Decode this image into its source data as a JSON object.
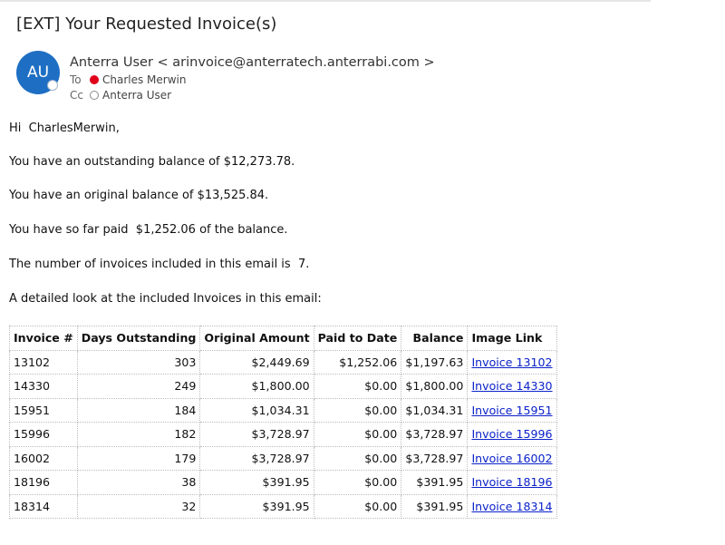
{
  "email": {
    "subject": "[EXT] Your Requested Invoice(s)",
    "avatar_initials": "AU",
    "sender_line": "Anterra User < arinvoice@anterratech.anterrabi.com >",
    "to_label": "To",
    "to_name": "Charles Merwin",
    "cc_label": "Cc",
    "cc_name": "Anterra User",
    "status_colors": {
      "to": "#e0001b",
      "avatar": "#1e6fc4",
      "link": "#0b22c9"
    }
  },
  "body": {
    "greeting": "Hi  CharlesMerwin,",
    "outstanding": "You have an outstanding balance of $12,273.78.",
    "original": "You have an original balance of $13,525.84.",
    "paid": "You have so far paid  $1,252.06 of the balance.",
    "count": "The number of invoices included in this email is  7.",
    "detail_intro": "A detailed look at the included Invoices in this email:"
  },
  "table": {
    "headers": [
      "Invoice #",
      "Days Outstanding",
      "Original Amount",
      "Paid to Date",
      "Balance",
      "Image Link"
    ],
    "rows": [
      [
        "13102",
        "303",
        "$2,449.69",
        "$1,252.06",
        "$1,197.63",
        "Invoice 13102"
      ],
      [
        "14330",
        "249",
        "$1,800.00",
        "$0.00",
        "$1,800.00",
        "Invoice 14330"
      ],
      [
        "15951",
        "184",
        "$1,034.31",
        "$0.00",
        "$1,034.31",
        "Invoice 15951"
      ],
      [
        "15996",
        "182",
        "$3,728.97",
        "$0.00",
        "$3,728.97",
        "Invoice 15996"
      ],
      [
        "16002",
        "179",
        "$3,728.97",
        "$0.00",
        "$3,728.97",
        "Invoice 16002"
      ],
      [
        "18196",
        "38",
        "$391.95",
        "$0.00",
        "$391.95",
        "Invoice 18196"
      ],
      [
        "18314",
        "32",
        "$391.95",
        "$0.00",
        "$391.95",
        "Invoice 18314"
      ]
    ]
  }
}
